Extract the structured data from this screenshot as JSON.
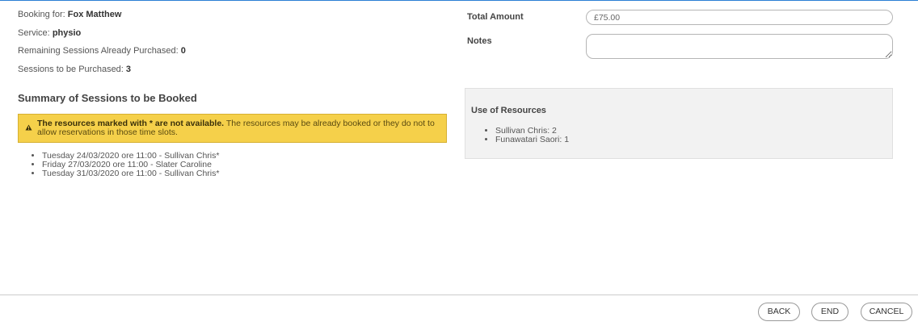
{
  "booking": {
    "booking_for_label": "Booking for:",
    "booking_for_value": "Fox Matthew",
    "service_label": "Service:",
    "service_value": "physio",
    "remaining_label": "Remaining Sessions Already Purchased:",
    "remaining_value": "0",
    "to_purchase_label": "Sessions to be Purchased:",
    "to_purchase_value": "3"
  },
  "summary": {
    "title": "Summary of Sessions to be Booked",
    "warning_bold": "The resources marked with * are not available.",
    "warning_text": "The resources may be already booked or they do not to allow reservations in those time slots.",
    "sessions": [
      "Tuesday 24/03/2020 ore 11:00 - Sullivan Chris*",
      "Friday 27/03/2020 ore 11:00 - Slater Caroline",
      "Tuesday 31/03/2020 ore 11:00 - Sullivan Chris*"
    ]
  },
  "form": {
    "total_amount_label": "Total Amount",
    "total_amount_value": "£75.00",
    "notes_label": "Notes",
    "notes_value": ""
  },
  "resources": {
    "title": "Use of Resources",
    "items": [
      "Sullivan Chris: 2",
      "Funawatari Saori: 1"
    ]
  },
  "footer": {
    "back_label": "BACK",
    "end_label": "END",
    "cancel_label": "CANCEL"
  },
  "colors": {
    "accent_top_border": "#2a7fd4",
    "warning_background": "#f5d04a",
    "panel_background": "#f2f2f2"
  },
  "icons": {
    "warning": "warning-triangle-icon"
  }
}
